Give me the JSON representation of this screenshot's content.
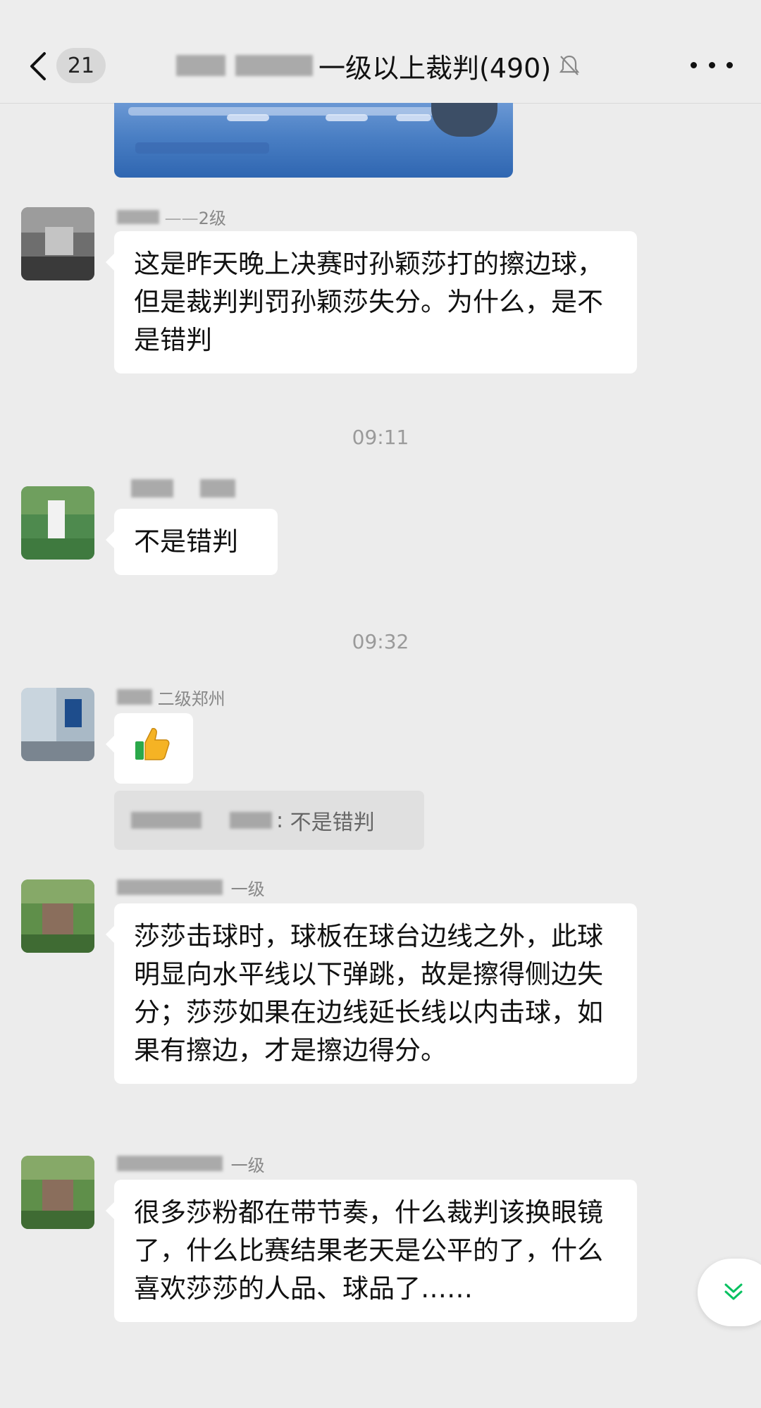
{
  "header": {
    "unread_count": "21",
    "title": "一级以上裁判(490)",
    "icons": {
      "back": "chevron-left-icon",
      "mute": "bell-muted-icon",
      "more": "more-dots-icon"
    }
  },
  "messages": [
    {
      "sender": "2级",
      "text": "这是昨天晚上决赛时孙颖莎打的擦边球，但是裁判判罚孙颖莎失分。为什么，是不是错判"
    },
    {
      "sender": "",
      "text": "不是错判"
    },
    {
      "sender": "二级郑州",
      "text": "",
      "emoji": "thumbs-up"
    },
    {
      "sender": "一级",
      "text": "莎莎击球时，球板在球台边线之外，此球明显向水平线以下弹跳，故是擦得侧边失分；莎莎如果在边线延长线以内击球，如果有擦边，才是擦边得分。"
    },
    {
      "sender": "一级",
      "text": "很多莎粉都在带节奏，什么裁判该换眼镜了，什么比赛结果老天是公平的了，什么喜欢莎莎的人品、球品了……"
    }
  ],
  "timestamps": [
    "09:11",
    "09:32"
  ],
  "quote": {
    "text": "不是错判"
  },
  "colors": {
    "background": "#ececec",
    "bubble": "#ffffff",
    "accent_green": "#07c160"
  }
}
